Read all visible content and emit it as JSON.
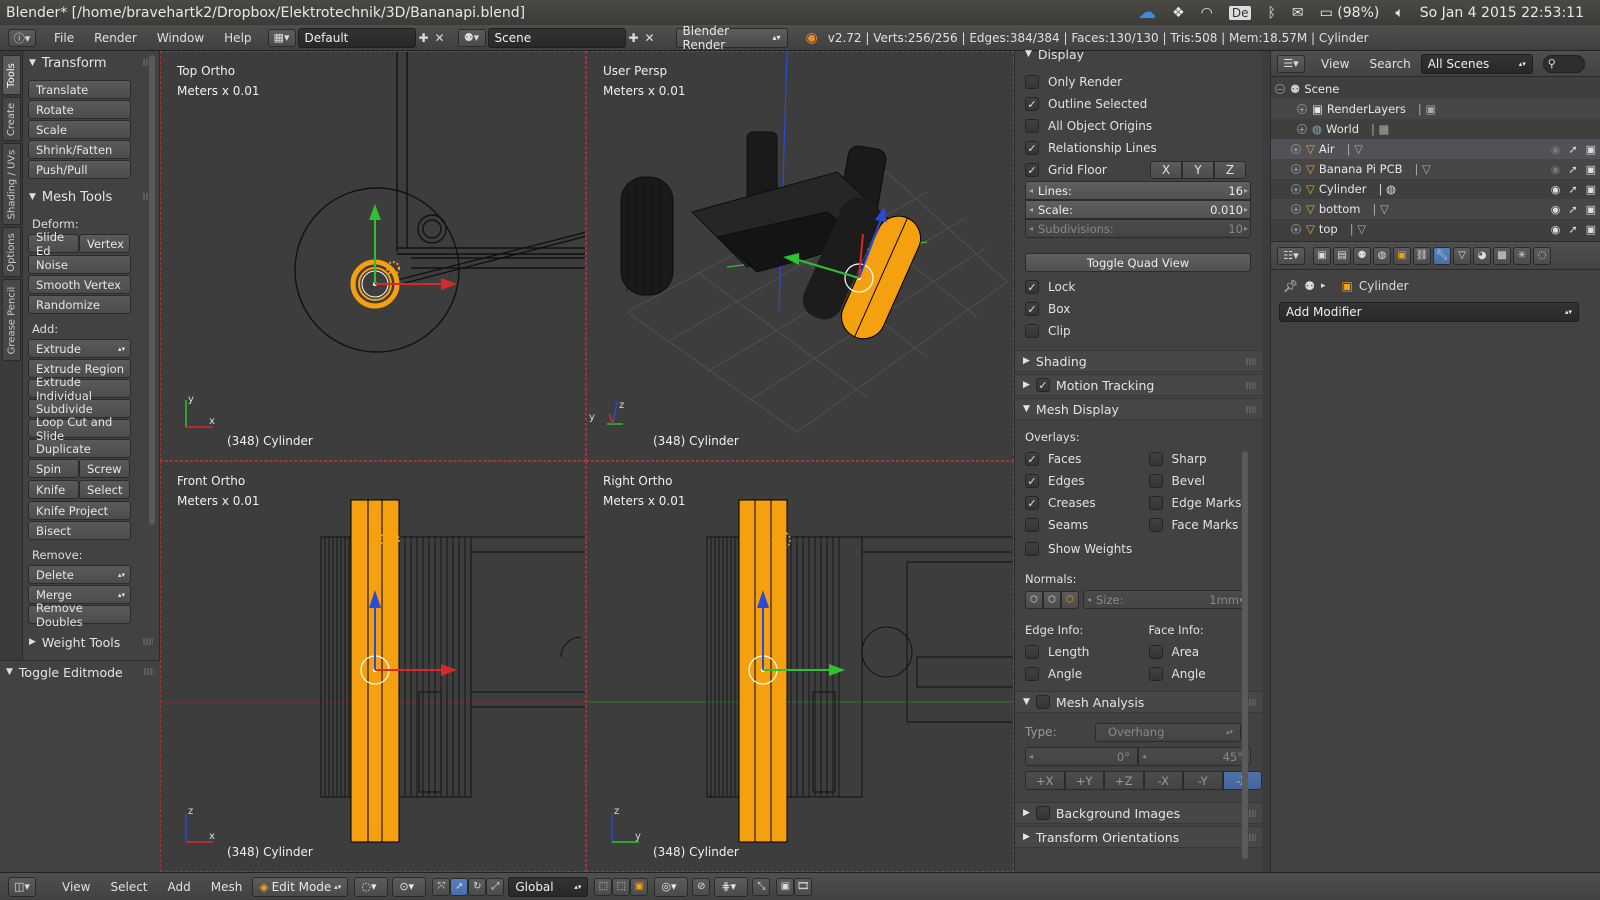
{
  "os_bar": {
    "title": "Blender* [/home/bravehartk2/Dropbox/Elektrotechnik/3D/Bananapi.blend]",
    "keyboard_layout": "De",
    "battery": "(98%)",
    "datetime": "So Jan  4 2015 22:53:11"
  },
  "menubar": {
    "menus": [
      "File",
      "Render",
      "Window",
      "Help"
    ],
    "screen_layout": "Default",
    "scene": "Scene",
    "engine": "Blender Render",
    "stats": "v2.72 | Verts:256/256 | Edges:384/384 | Faces:130/130 | Tris:508 | Mem:18.57M | Cylinder"
  },
  "tool_tabs": [
    "Tools",
    "Create",
    "Shading / UVs",
    "Options",
    "Grease Pencil"
  ],
  "toolshelf": {
    "transform_title": "Transform",
    "transform": [
      "Translate",
      "Rotate",
      "Scale",
      "Shrink/Fatten",
      "Push/Pull"
    ],
    "mesh_tools_title": "Mesh Tools",
    "deform_label": "Deform:",
    "slide_edge": "Slide Ed",
    "vertex": "Vertex",
    "noise": "Noise",
    "smooth_vertex": "Smooth Vertex",
    "randomize": "Randomize",
    "add_label": "Add:",
    "extrude": "Extrude",
    "extrude_region": "Extrude Region",
    "extrude_individual": "Extrude Individual",
    "subdivide": "Subdivide",
    "loop_cut": "Loop Cut and Slide",
    "duplicate": "Duplicate",
    "spin": "Spin",
    "screw": "Screw",
    "knife": "Knife",
    "select": "Select",
    "knife_project": "Knife Project",
    "bisect": "Bisect",
    "remove_label": "Remove:",
    "delete": "Delete",
    "merge": "Merge",
    "remove_doubles": "Remove Doubles",
    "weight_tools": "Weight Tools",
    "toggle_editmode": "Toggle Editmode"
  },
  "viewports": {
    "unit": "Meters x 0.01",
    "object": "(348) Cylinder",
    "top_left": "Top Ortho",
    "top_right": "User Persp",
    "bottom_left": "Front Ortho",
    "bottom_right": "Right Ortho"
  },
  "props": {
    "display": "Display",
    "only_render": "Only Render",
    "outline_selected": "Outline Selected",
    "all_object_origins": "All Object Origins",
    "relationship_lines": "Relationship Lines",
    "grid_floor": "Grid Floor",
    "axis_x": "X",
    "axis_y": "Y",
    "axis_z": "Z",
    "lines_label": "Lines:",
    "lines_value": "16",
    "scale_label": "Scale:",
    "scale_value": "0.010",
    "subdiv_label": "Subdivisions:",
    "subdiv_value": "10",
    "toggle_quad": "Toggle Quad View",
    "lock": "Lock",
    "box": "Box",
    "clip": "Clip",
    "shading": "Shading",
    "motion_tracking": "Motion Tracking",
    "mesh_display": "Mesh Display",
    "overlays_label": "Overlays:",
    "faces": "Faces",
    "sharp": "Sharp",
    "edges": "Edges",
    "bevel": "Bevel",
    "creases": "Creases",
    "edge_marks": "Edge Marks",
    "seams": "Seams",
    "face_marks": "Face Marks",
    "show_weights": "Show Weights",
    "normals_label": "Normals:",
    "size_label": "Size:",
    "size_value": "1mm",
    "edge_info": "Edge Info:",
    "face_info": "Face Info:",
    "length": "Length",
    "area": "Area",
    "angle_e": "Angle",
    "angle_f": "Angle",
    "mesh_analysis": "Mesh Analysis",
    "type_label": "Type:",
    "type_value": "Overhang",
    "range_min": "0°",
    "range_max": "45°",
    "axes": [
      "+X",
      "+Y",
      "+Z",
      "-X",
      "-Y",
      "-Z"
    ],
    "background_images": "Background Images",
    "transform_orientations": "Transform Orientations"
  },
  "outliner": {
    "view": "View",
    "search": "Search",
    "filter": "All Scenes",
    "scene": "Scene",
    "items": [
      "RenderLayers",
      "World",
      "Air",
      "Banana Pi PCB",
      "Cylinder",
      "bottom",
      "top"
    ]
  },
  "modifier": {
    "object": "Cylinder",
    "add_modifier": "Add Modifier"
  },
  "bottombar": {
    "menus": [
      "View",
      "Select",
      "Add",
      "Mesh"
    ],
    "mode": "Edit Mode",
    "orientation": "Global"
  },
  "colors": {
    "selected_orange": "#f5a00e",
    "axis_red": "#d62a2a",
    "axis_green": "#2fc22f",
    "axis_blue": "#2a4bd6"
  }
}
